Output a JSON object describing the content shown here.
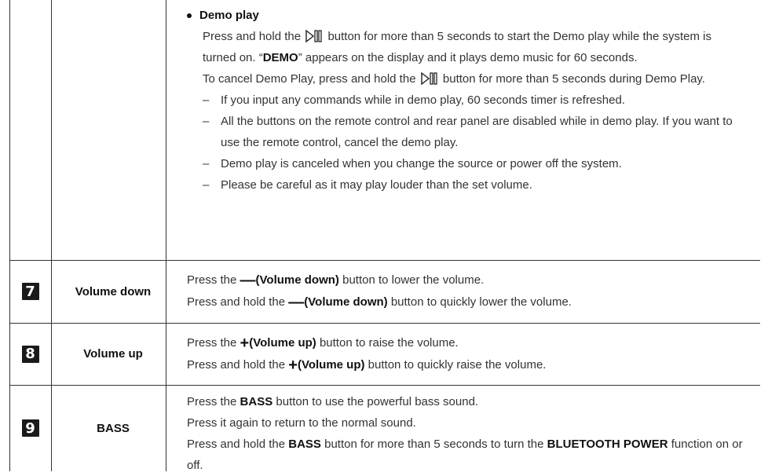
{
  "demo": {
    "title": "Demo play",
    "para1_a": "Press and hold the",
    "para1_b": "button for more than 5 seconds to start the Demo play while the system is turned on. “",
    "demo_word": "DEMO",
    "para1_c": "” appears on the display and it plays demo music for 60 seconds.",
    "para2_a": "To cancel Demo Play, press and hold the",
    "para2_b": "button for more than 5 seconds during Demo Play.",
    "dash": "–",
    "notes": [
      "If you input any commands while in demo play, 60 seconds timer is refreshed.",
      "All the buttons on the remote control and rear panel are disabled while in demo play. If you want to use the remote control, cancel the demo play.",
      "Demo play is canceled when you change the source or power off the system.",
      "Please be careful as it may play louder than the set volume."
    ]
  },
  "rows": [
    {
      "number": "7",
      "name": "Volume down",
      "symbol": "—",
      "line1_a": "Press the",
      "line1_bold": "(Volume down)",
      "line1_b": "button to lower the volume.",
      "line2_a": "Press and hold the",
      "line2_bold": "(Volume down)",
      "line2_b": "button to quickly lower the volume."
    },
    {
      "number": "8",
      "name": "Volume up",
      "symbol": "+",
      "line1_a": "Press the",
      "line1_bold": "(Volume up)",
      "line1_b": "button to raise the volume.",
      "line2_a": "Press and hold the",
      "line2_bold": "(Volume up)",
      "line2_b": "button to quickly raise the volume."
    },
    {
      "number": "9",
      "name": "BASS",
      "line1_a": "Press the",
      "line1_bold": "BASS",
      "line1_b": "button to use the powerful bass sound.",
      "line2": "Press it again to return to the normal sound.",
      "line3_a": "Press and hold the",
      "line3_bold": "BASS",
      "line3_b": "button for more than 5 seconds to turn the",
      "line3_bold2": "BLUETOOTH POWER",
      "line3_c": "function on or off."
    }
  ]
}
